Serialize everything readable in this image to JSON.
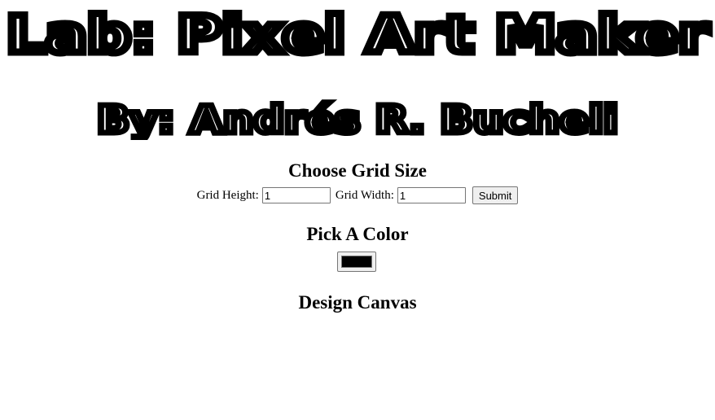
{
  "title": "Lab: Pixel Art Maker",
  "subtitle": "By: Andrés R. Bucheli",
  "grid_size": {
    "heading": "Choose Grid Size",
    "height_label": "Grid Height:",
    "height_value": "1",
    "width_label": "Grid Width:",
    "width_value": "1",
    "submit_label": "Submit"
  },
  "color": {
    "heading": "Pick A Color",
    "value": "#000000"
  },
  "canvas": {
    "heading": "Design Canvas"
  }
}
